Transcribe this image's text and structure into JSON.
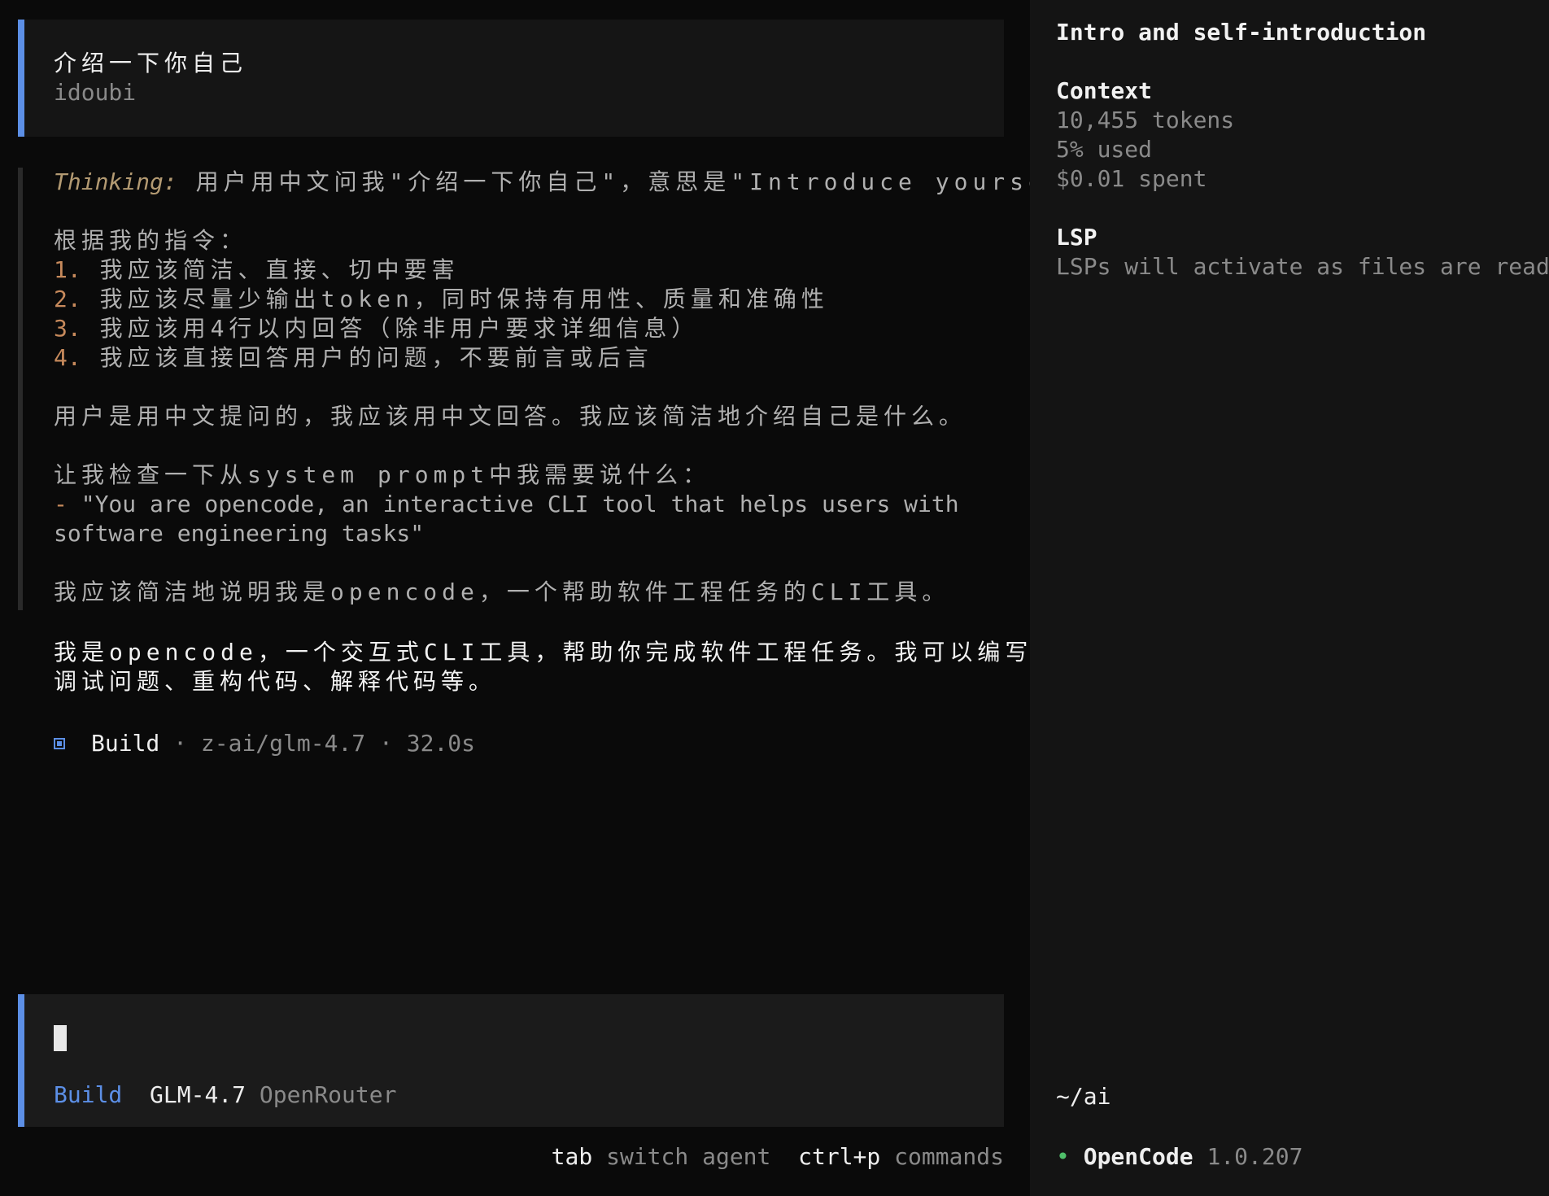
{
  "session": {
    "user_message": "介绍一下你自己",
    "user_name": "idoubi"
  },
  "thinking": {
    "label": "Thinking:",
    "first_line": " 用户用中文问我\"介绍一下你自己\"，意思是\"Introduce yourself\"。",
    "intro": "根据我的指令：",
    "rules": [
      {
        "num": "1.",
        "text": " 我应该简洁、直接、切中要害"
      },
      {
        "num": "2.",
        "text": " 我应该尽量少输出token，同时保持有用性、质量和准确性"
      },
      {
        "num": "3.",
        "text": " 我应该用4行以内回答（除非用户要求详细信息）"
      },
      {
        "num": "4.",
        "text": " 我应该直接回答用户的问题，不要前言或后言"
      }
    ],
    "para2": "用户是用中文提问的，我应该用中文回答。我应该简洁地介绍自己是什么。",
    "para3": "让我检查一下从system prompt中我需要说什么：",
    "quote_dash": "-",
    "quote_line1": " \"You are opencode, an interactive CLI tool that helps users with",
    "quote_line2": "software engineering tasks\"",
    "para4": "我应该简洁地说明我是opencode，一个帮助软件工程任务的CLI工具。"
  },
  "answer": {
    "line1": "我是opencode，一个交互式CLI工具，帮助你完成软件工程任务。我可以编写代码、",
    "line2": "调试问题、重构代码、解释代码等。"
  },
  "build_status": {
    "agent": "Build",
    "meta": " · z-ai/glm-4.7 · 32.0s"
  },
  "input": {
    "agent": "Build",
    "model": "GLM-4.7",
    "provider": "OpenRouter"
  },
  "hints": {
    "tab_key": "tab",
    "tab_desc": "switch agent",
    "cmd_key": "ctrl+p",
    "cmd_desc": "commands"
  },
  "sidebar": {
    "title": "Intro and self-introduction",
    "context_heading": "Context",
    "tokens": "10,455 tokens",
    "used": "5% used",
    "spent": "$0.01 spent",
    "lsp_heading": "LSP",
    "lsp_text": "LSPs will activate as files are read",
    "path": "~/ai",
    "app_name": "OpenCode",
    "version": "1.0.207"
  },
  "colors": {
    "accent": "#5c8fe6",
    "number_accent": "#c78a5c",
    "thinking_label": "#b39a72",
    "status_dot": "#4fbf6a"
  }
}
